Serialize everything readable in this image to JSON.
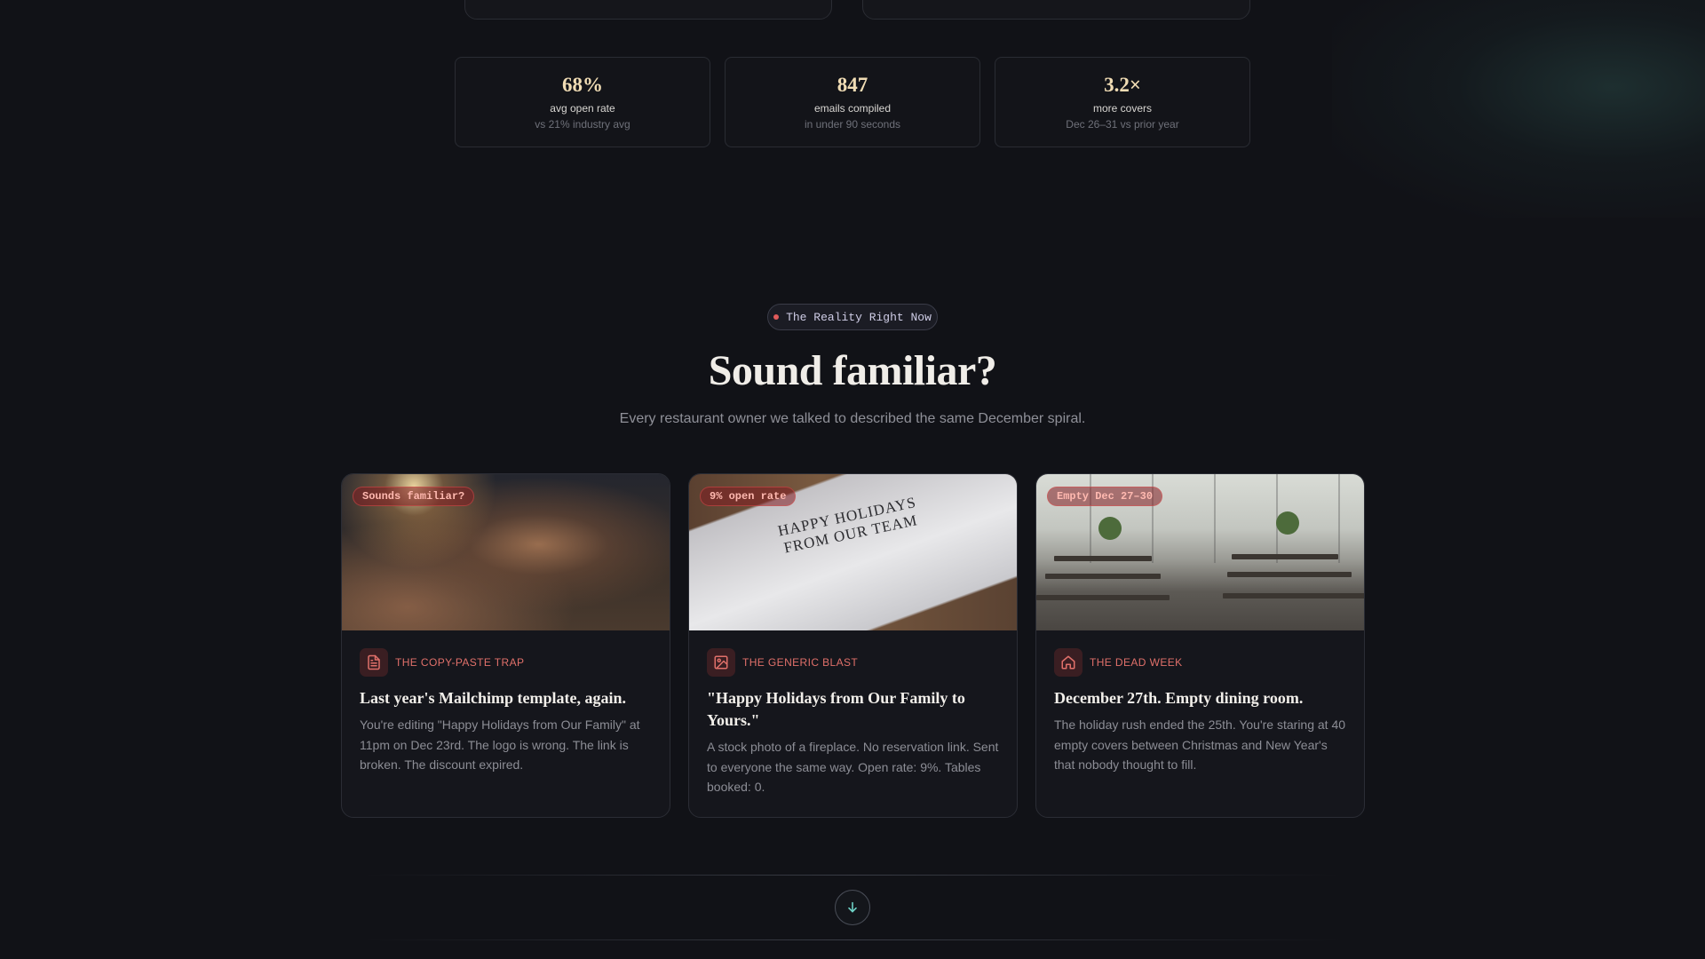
{
  "stats": [
    {
      "value": "68%",
      "label": "avg open rate",
      "note": "vs 21% industry avg"
    },
    {
      "value": "847",
      "label": "emails compiled",
      "note": "in under 90 seconds"
    },
    {
      "value": "3.2×",
      "label": "more covers",
      "note": "Dec 26–31 vs prior year"
    }
  ],
  "section": {
    "pill": "The Reality Right Now",
    "headline": "Sound familiar?",
    "subhead": "Every restaurant owner we talked to described the same December spiral."
  },
  "cards": [
    {
      "badge": "Sounds familiar?",
      "icon": "document-icon",
      "category": "THE COPY-PASTE TRAP",
      "title": "Last year's Mailchimp template, again.",
      "text": "You're editing \"Happy Holidays from Our Family\" at 11pm on Dec 23rd. The logo is wrong. The link is broken. The discount expired."
    },
    {
      "badge": "9% open rate",
      "icon": "image-icon",
      "category": "THE GENERIC BLAST",
      "title": "\"Happy Holidays from Our Family to Yours.\"",
      "text": "A stock photo of a fireplace. No reservation link. Sent to everyone the same way. Open rate: 9%. Tables booked: 0.",
      "image_text": "HAPPY HOLIDAYS FROM OUR TEAM"
    },
    {
      "badge": "Empty Dec 27–30",
      "icon": "home-icon",
      "category": "THE DEAD WEEK",
      "title": "December 27th. Empty dining room.",
      "text": "The holiday rush ended the 25th. You're staring at 40 empty covers between Christmas and New Year's that nobody thought to fill."
    }
  ],
  "colors": {
    "accent": "#e0706a",
    "stat_value": "#f0dcb4",
    "background": "#111217"
  },
  "scroll_icon": "arrow-down-icon"
}
